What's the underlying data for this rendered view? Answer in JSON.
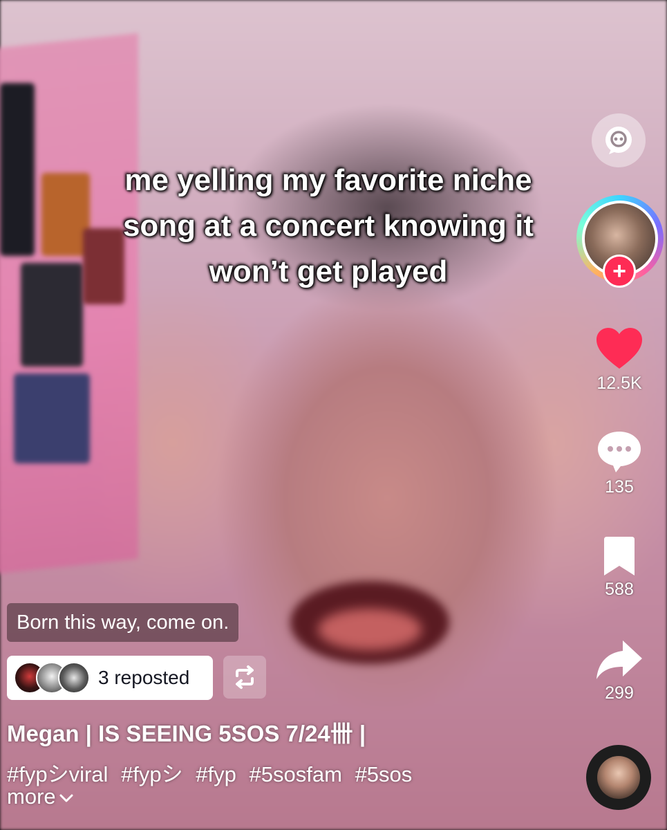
{
  "video": {
    "overlay_caption": "me yelling my favorite niche song at a concert knowing it won’t get played"
  },
  "rail": {
    "likes": {
      "count": "12.5K",
      "icon": "heart-icon",
      "color": "#fe2c55"
    },
    "comments": {
      "count": "135",
      "icon": "comment-icon"
    },
    "saves": {
      "count": "588",
      "icon": "bookmark-icon"
    },
    "shares": {
      "count": "299",
      "icon": "share-icon"
    },
    "follow_label": "+"
  },
  "sound": {
    "label": "Born this way, come on."
  },
  "repost": {
    "label": "3 reposted"
  },
  "post": {
    "author": "Megan | IS SEEING 5SOS 7/24卌 |",
    "hashtags": [
      "#fypシviral",
      "#fypシ",
      "#fyp",
      "#5sosfam",
      "#5sos"
    ],
    "more_label": "more"
  },
  "colors": {
    "accent": "#fe2c55",
    "text": "#ffffff"
  }
}
